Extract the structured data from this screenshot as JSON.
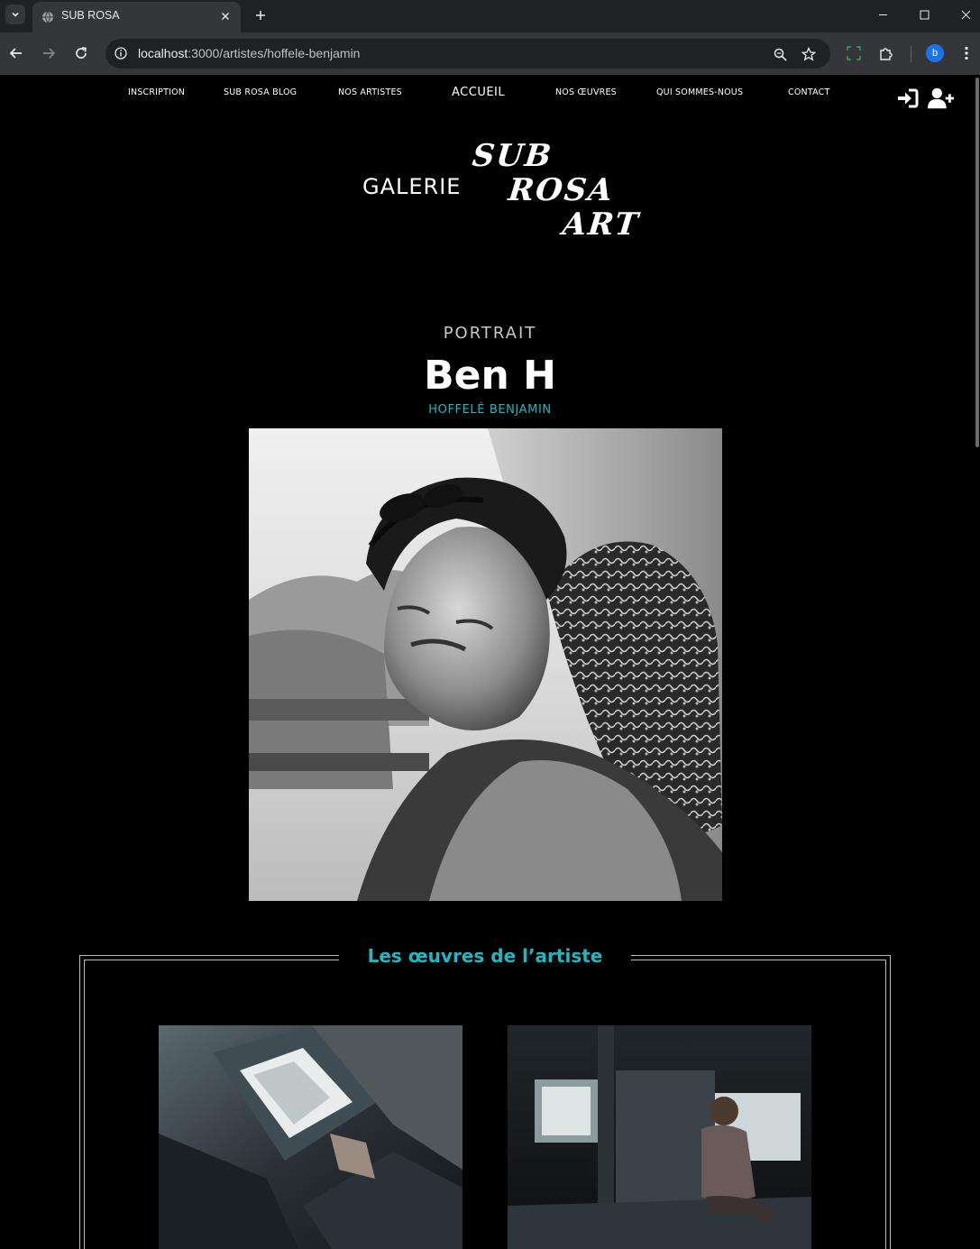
{
  "browser": {
    "tab_title": "SUB ROSA",
    "url_host": "localhost",
    "url_rest": ":3000/artistes/hoffele-benjamin",
    "profile_initial": "b"
  },
  "nav": {
    "items": [
      {
        "label": "INSCRIPTION"
      },
      {
        "label": "SUB ROSA BLOG"
      },
      {
        "label": "NOS ARTISTES"
      },
      {
        "label": "ACCUEIL"
      },
      {
        "label": "NOS ŒUVRES"
      },
      {
        "label": "QUI SOMMES-NOUS"
      },
      {
        "label": "CONTACT"
      }
    ]
  },
  "logo": {
    "galerie": "GALERIE",
    "sub": "SUB",
    "rosa": "ROSA",
    "art": "ART"
  },
  "artist": {
    "section_label": "PORTRAIT",
    "display_name": "Ben H",
    "full_name": "HOFFELÉ BENJAMIN"
  },
  "works": {
    "title": "Les œuvres de l’artiste"
  },
  "colors": {
    "accent": "#1fb8c2",
    "background": "#000000"
  }
}
